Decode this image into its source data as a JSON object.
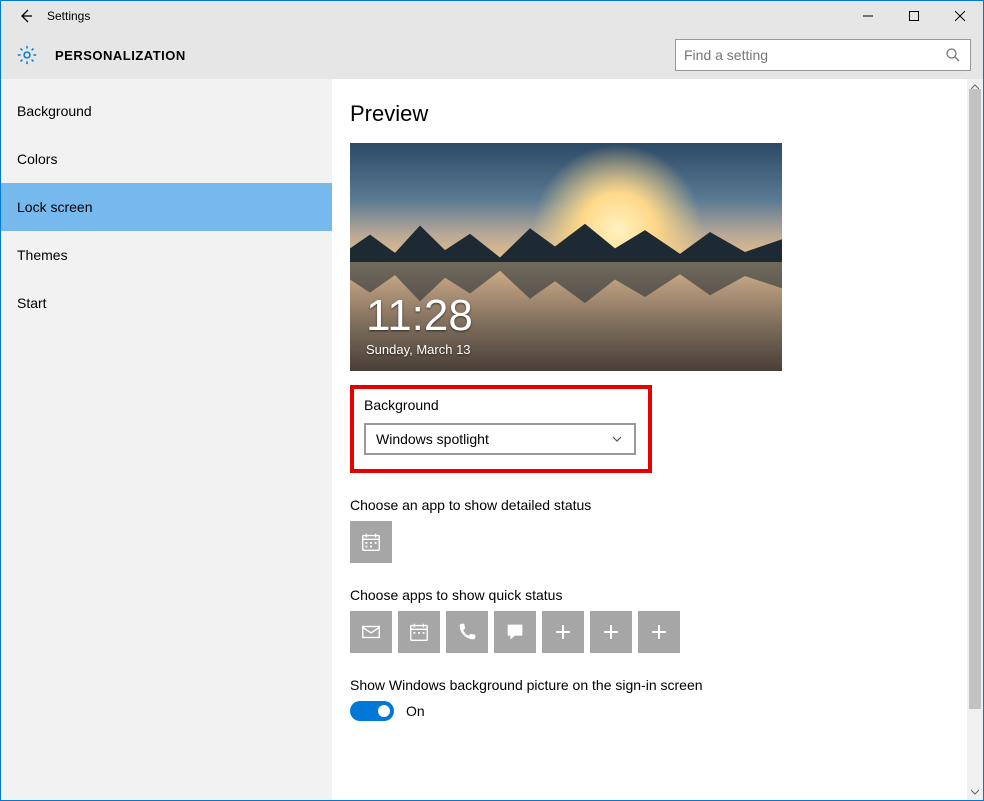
{
  "window": {
    "title": "Settings"
  },
  "header": {
    "category": "PERSONALIZATION",
    "search_placeholder": "Find a setting"
  },
  "sidebar": {
    "items": [
      {
        "label": "Background",
        "selected": false
      },
      {
        "label": "Colors",
        "selected": false
      },
      {
        "label": "Lock screen",
        "selected": true
      },
      {
        "label": "Themes",
        "selected": false
      },
      {
        "label": "Start",
        "selected": false
      }
    ]
  },
  "main": {
    "preview_heading": "Preview",
    "lock_time": "11:28",
    "lock_date": "Sunday, March 13",
    "background_label": "Background",
    "background_value": "Windows spotlight",
    "detailed_status_label": "Choose an app to show detailed status",
    "detailed_status_slots": [
      {
        "icon": "calendar-icon"
      }
    ],
    "quick_status_label": "Choose apps to show quick status",
    "quick_status_slots": [
      {
        "icon": "mail-icon"
      },
      {
        "icon": "calendar-icon"
      },
      {
        "icon": "phone-icon"
      },
      {
        "icon": "message-icon"
      },
      {
        "icon": "plus-icon"
      },
      {
        "icon": "plus-icon"
      },
      {
        "icon": "plus-icon"
      }
    ],
    "signin_bg_label": "Show Windows background picture on the sign-in screen",
    "signin_bg_toggle": {
      "on": true,
      "text": "On"
    }
  },
  "colors": {
    "accent": "#0078d7",
    "highlight_border": "#e60000",
    "sidebar_selected": "#76b9ed"
  }
}
